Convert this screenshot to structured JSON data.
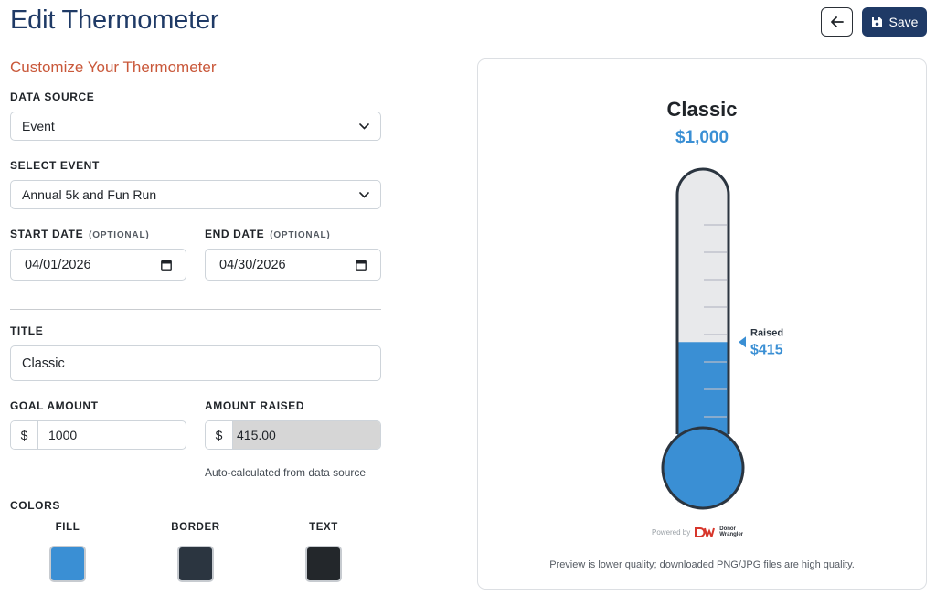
{
  "header": {
    "title": "Edit Thermometer",
    "save_label": "Save",
    "back_icon": "arrow-left-icon",
    "save_icon": "floppy-disk-icon",
    "primary_color": "#1f3a66"
  },
  "form": {
    "section_title": "Customize Your Thermometer",
    "data_source": {
      "label": "DATA SOURCE",
      "value": "Event"
    },
    "select_event": {
      "label": "SELECT EVENT",
      "value": "Annual 5k and Fun Run"
    },
    "start_date": {
      "label": "START DATE",
      "optional": "(OPTIONAL)",
      "value": "04/01/2026"
    },
    "end_date": {
      "label": "END DATE",
      "optional": "(OPTIONAL)",
      "value": "04/30/2026"
    },
    "title_field": {
      "label": "TITLE",
      "value": "Classic"
    },
    "goal_amount": {
      "label": "GOAL AMOUNT",
      "prefix": "$",
      "value": "1000"
    },
    "amount_raised": {
      "label": "AMOUNT RAISED",
      "prefix": "$",
      "value": "415.00",
      "help": "Auto-calculated from data source"
    },
    "colors": {
      "label": "COLORS",
      "fill": {
        "label": "FILL",
        "color": "#3a8fd4"
      },
      "border": {
        "label": "BORDER",
        "color": "#2b3540"
      },
      "text": {
        "label": "TEXT",
        "color": "#23272b"
      }
    }
  },
  "preview": {
    "title": "Classic",
    "goal": "$1,000",
    "raised_label": "Raised",
    "raised_value": "$415",
    "fill_fraction": 0.415,
    "powered_by": "Powered by",
    "brand_line1": "Donor",
    "brand_line2": "Wrangler",
    "note": "Preview is lower quality; downloaded PNG/JPG files are high quality."
  }
}
